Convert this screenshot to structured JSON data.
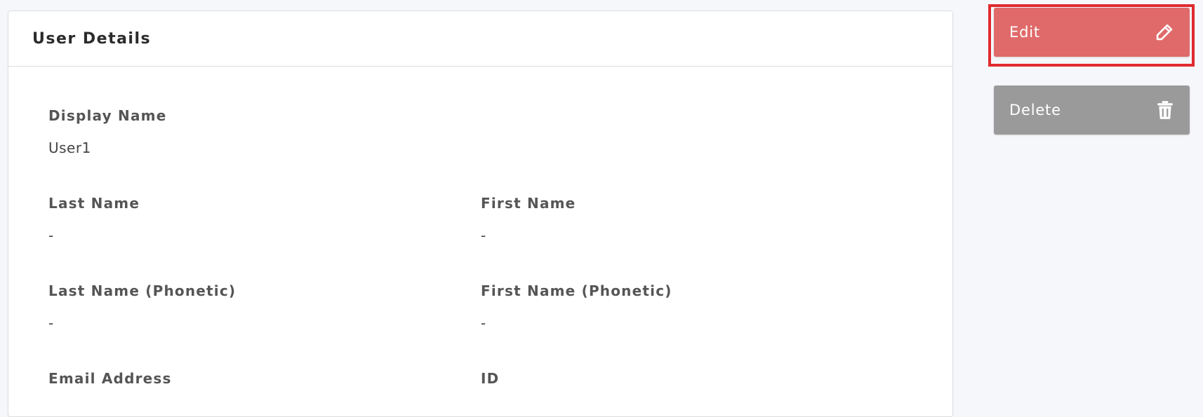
{
  "card": {
    "title": "User Details"
  },
  "fields": {
    "display_name": {
      "label": "Display Name",
      "value": "User1"
    },
    "last_name": {
      "label": "Last Name",
      "value": "-"
    },
    "first_name": {
      "label": "First Name",
      "value": "-"
    },
    "last_name_phonetic": {
      "label": "Last Name (Phonetic)",
      "value": "-"
    },
    "first_name_phonetic": {
      "label": "First Name (Phonetic)",
      "value": "-"
    },
    "email_address": {
      "label": "Email Address"
    },
    "id": {
      "label": "ID"
    }
  },
  "actions": {
    "edit": {
      "label": "Edit",
      "icon": "pencil-icon",
      "color": "#e06a6a",
      "highlighted": true,
      "highlight_color": "#e02a2f"
    },
    "delete": {
      "label": "Delete",
      "icon": "trash-icon",
      "color": "#9a9a9a"
    }
  }
}
